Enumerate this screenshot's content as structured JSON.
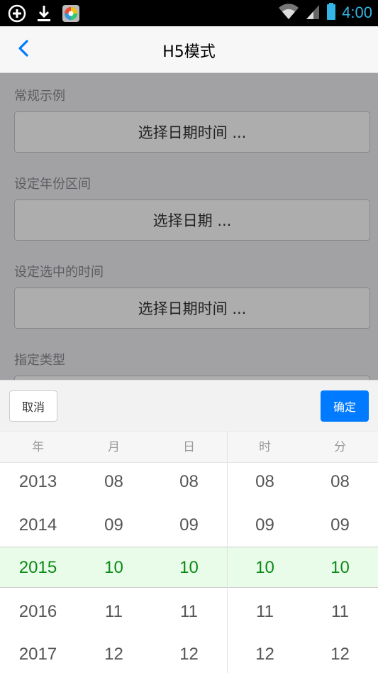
{
  "status_bar": {
    "time": "4:00",
    "icons": [
      "add-circle-icon",
      "download-icon",
      "app-icon",
      "wifi-icon",
      "signal-icon",
      "battery-icon"
    ]
  },
  "nav": {
    "back_icon": "chevron-left-icon",
    "title": "H5模式"
  },
  "sections": [
    {
      "title": "常规示例",
      "button": "选择日期时间 ..."
    },
    {
      "title": "设定年份区间",
      "button": "选择日期 ..."
    },
    {
      "title": "设定选中的时间",
      "button": "选择日期时间 ..."
    },
    {
      "title": "指定类型",
      "button": ""
    }
  ],
  "picker": {
    "cancel_label": "取消",
    "ok_label": "确定",
    "columns": [
      "年",
      "月",
      "日",
      "时",
      "分"
    ],
    "values": {
      "year": [
        "2013",
        "2014",
        "2015",
        "2016",
        "2017"
      ],
      "month": [
        "08",
        "09",
        "10",
        "11",
        "12"
      ],
      "day": [
        "08",
        "09",
        "10",
        "11",
        "12"
      ],
      "hour": [
        "08",
        "09",
        "10",
        "11",
        "12"
      ],
      "minute": [
        "08",
        "09",
        "10",
        "11",
        "12"
      ]
    },
    "selected": {
      "year": "2015",
      "month": "10",
      "day": "10",
      "hour": "10",
      "minute": "10"
    }
  },
  "colors": {
    "accent": "#007aff",
    "selected_text": "#0a8a16",
    "selected_bg": "#e9fbe9",
    "status_time": "#33b5e5"
  }
}
